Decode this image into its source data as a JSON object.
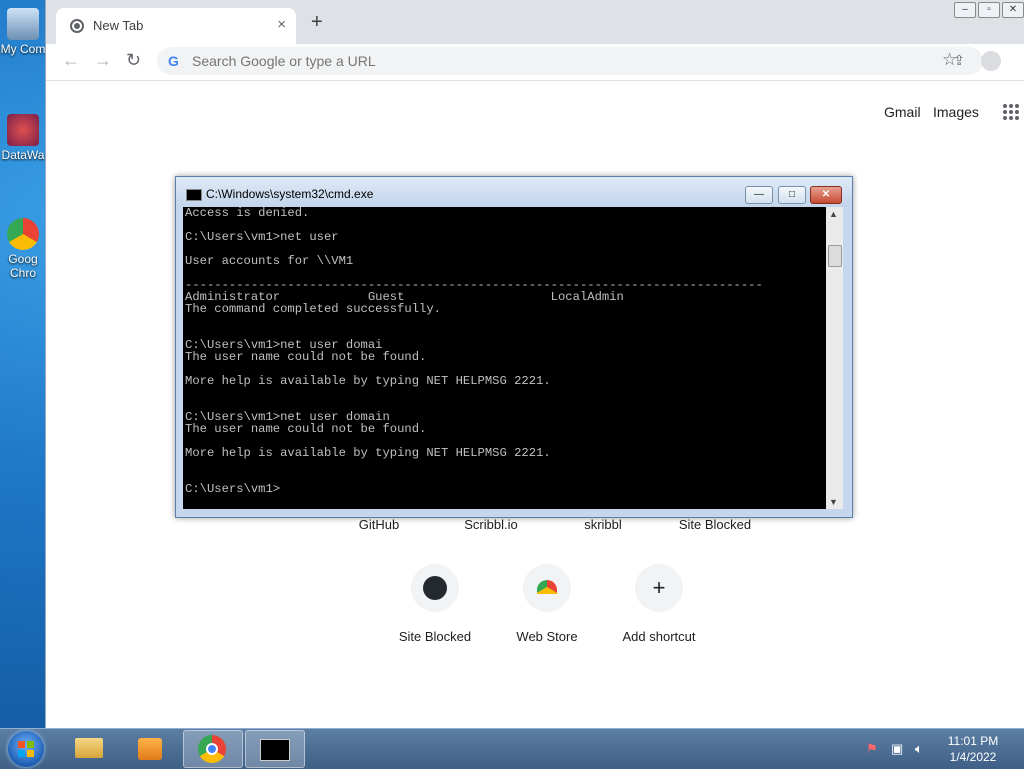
{
  "desktop": {
    "icons": [
      {
        "label": "My Com"
      },
      {
        "label": "DataWa"
      },
      {
        "label": "Goog Chro"
      }
    ]
  },
  "browser": {
    "tab": {
      "title": "New Tab",
      "close": "×"
    },
    "new_tab": "+",
    "window_controls": {
      "minimize": "–",
      "maximize": "▫",
      "close": "✕"
    },
    "nav": {
      "back": "←",
      "forward": "→",
      "reload": "↻"
    },
    "omnibox": {
      "placeholder": "Search Google or type a URL"
    },
    "header_links": {
      "gmail": "Gmail",
      "images": "Images"
    },
    "top_sites": [
      "GitHub",
      "Scribbl.io",
      "skribbl",
      "Site Blocked"
    ],
    "shortcuts": [
      {
        "label": "Site Blocked",
        "icon": "github-icon"
      },
      {
        "label": "Web Store",
        "icon": "web-store-icon"
      },
      {
        "label": "Add shortcut",
        "icon": "plus-icon",
        "glyph": "+"
      }
    ]
  },
  "cmd": {
    "title": "C:\\Windows\\system32\\cmd.exe",
    "buttons": {
      "minimize": "—",
      "maximize": "□",
      "close": "✕"
    },
    "lines": [
      "Access is denied.",
      "",
      "C:\\Users\\vm1>net user",
      "",
      "User accounts for \\\\VM1",
      "",
      "-------------------------------------------------------------------------------",
      "Administrator            Guest                    LocalAdmin",
      "The command completed successfully.",
      "",
      "",
      "C:\\Users\\vm1>net user domai",
      "The user name could not be found.",
      "",
      "More help is available by typing NET HELPMSG 2221.",
      "",
      "",
      "C:\\Users\\vm1>net user domain",
      "The user name could not be found.",
      "",
      "More help is available by typing NET HELPMSG 2221.",
      "",
      "",
      "C:\\Users\\vm1>"
    ]
  },
  "taskbar": {
    "clock": {
      "time": "11:01 PM",
      "date": "1/4/2022"
    }
  }
}
